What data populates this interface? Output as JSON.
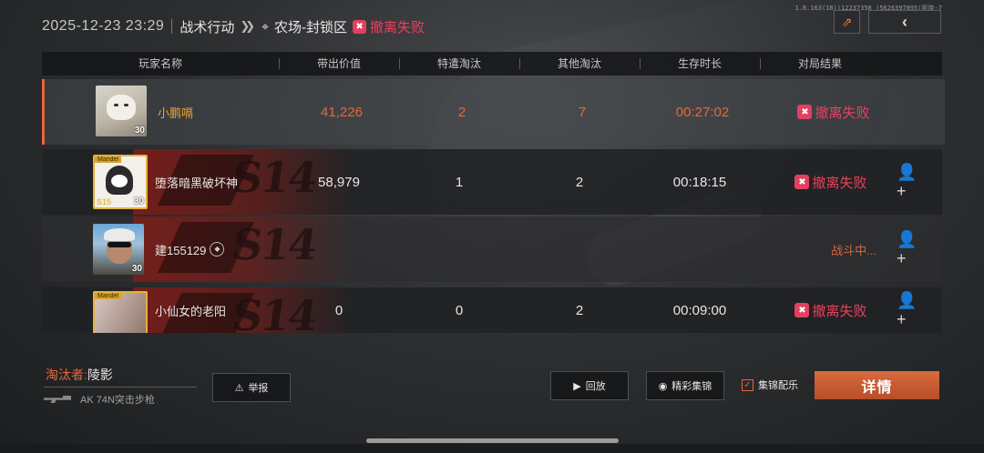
{
  "device_info": "1.8.163(18)|12237358 |5626397895|凯旋-7",
  "header": {
    "datetime": "2025-12-23 23:29",
    "mode": "战术行动",
    "map": "农场-封锁区",
    "result": "撤离失败"
  },
  "columns": [
    "玩家名称",
    "带出价值",
    "特遣淘汰",
    "其他淘汰",
    "生存时长",
    "对局结果"
  ],
  "players": [
    {
      "name": "小鹏嗝",
      "level": "30",
      "value": "41,226",
      "squad_kills": "2",
      "other_kills": "7",
      "survival": "00:27:02",
      "result": "撤离失败"
    },
    {
      "name": "堕落暗黑破坏神",
      "level": "30",
      "badge_tag": "Mandel",
      "badge_sub": "S15",
      "value": "58,979",
      "squad_kills": "1",
      "other_kills": "2",
      "survival": "00:18:15",
      "result": "撤离失败"
    },
    {
      "name": "建155129",
      "level": "30",
      "status": "战斗中..."
    },
    {
      "name": "小仙女的老阳",
      "badge_tag": "Mandel",
      "value": "0",
      "squad_kills": "0",
      "other_kills": "2",
      "survival": "00:09:00",
      "result": "撤离失败"
    }
  ],
  "banner_text": "S14",
  "eliminator": {
    "label": "淘汰者:",
    "name": "陵影",
    "weapon": "AK 74N突击步枪"
  },
  "buttons": {
    "report": "举报",
    "replay": "回放",
    "highlights": "精彩集锦",
    "bgm": "集锦配乐",
    "details": "详情"
  },
  "icons": {
    "share": "share-icon",
    "back": "back-icon",
    "add_friend": "add-friend-icon"
  },
  "colors": {
    "accent": "#e5683a",
    "fail": "#e8415e",
    "gold": "#e3b13c"
  }
}
